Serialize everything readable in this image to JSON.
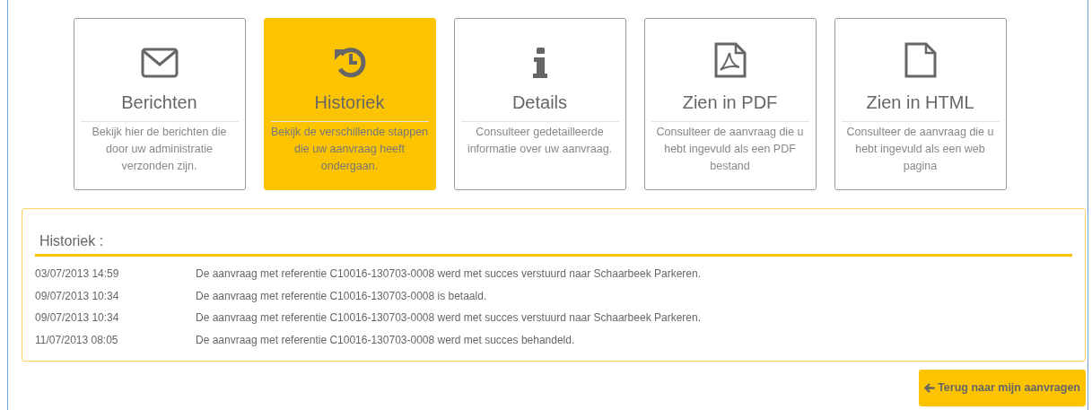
{
  "tiles": [
    {
      "title": "Berichten",
      "description": "Bekijk hier de berichten die door uw administratie verzonden zijn.",
      "selected": false
    },
    {
      "title": "Historiek",
      "description": "Bekijk de verschillende stappen die uw aanvraag heeft ondergaan.",
      "selected": true
    },
    {
      "title": "Details",
      "description": "Consulteer gedetailleerde informatie over uw aanvraag.",
      "selected": false
    },
    {
      "title": "Zien in PDF",
      "description": "Consulteer de aanvraag die u hebt ingevuld als een PDF bestand",
      "selected": false
    },
    {
      "title": "Zien in HTML",
      "description": "Consulteer de aanvraag die u hebt ingevuld als een web pagina",
      "selected": false
    }
  ],
  "history": {
    "title": "Historiek :",
    "rows": [
      {
        "date": "03/07/2013 14:59",
        "message": "De aanvraag met referentie C10016-130703-0008 werd met succes verstuurd naar Schaarbeek Parkeren."
      },
      {
        "date": "09/07/2013 10:34",
        "message": "De aanvraag met referentie C10016-130703-0008 is betaald."
      },
      {
        "date": "09/07/2013 10:34",
        "message": "De aanvraag met referentie C10016-130703-0008 werd met succes verstuurd naar Schaarbeek Parkeren."
      },
      {
        "date": "11/07/2013 08:05",
        "message": "De aanvraag met referentie C10016-130703-0008 werd met succes behandeld."
      }
    ]
  },
  "back_button": "Terug naar mijn aanvragen"
}
